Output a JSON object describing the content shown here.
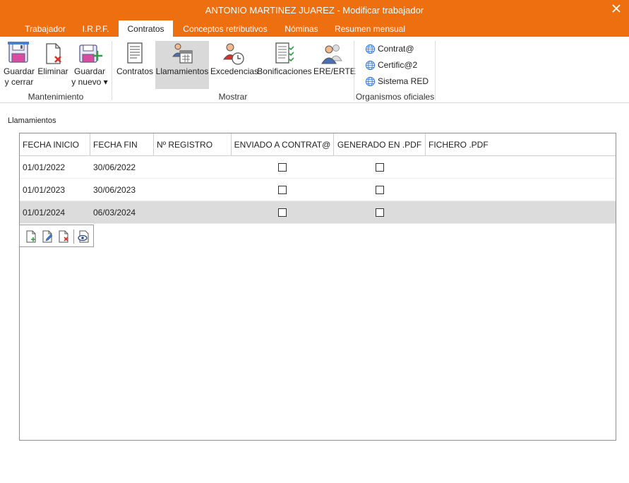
{
  "window": {
    "title": "ANTONIO MARTINEZ JUAREZ - Modificar trabajador"
  },
  "tabs": [
    {
      "label": "Trabajador",
      "active": false
    },
    {
      "label": "I.R.P.F.",
      "active": false
    },
    {
      "label": "Contratos",
      "active": true
    },
    {
      "label": "Conceptos retributivos",
      "active": false
    },
    {
      "label": "Nóminas",
      "active": false
    },
    {
      "label": "Resumen mensual",
      "active": false
    }
  ],
  "ribbon": {
    "mantenimiento": {
      "label": "Mantenimiento",
      "guardar_cerrar": {
        "line1": "Guardar",
        "line2": "y cerrar"
      },
      "eliminar": {
        "line1": "Eliminar"
      },
      "guardar_nuevo": {
        "line1": "Guardar",
        "line2": "y nuevo ▾"
      }
    },
    "mostrar": {
      "label": "Mostrar",
      "contratos": "Contratos",
      "llamamientos": "Llamamientos",
      "excedencias": "Excedencias",
      "bonificaciones": "Bonificaciones",
      "ere_erte": "ERE/ERTE"
    },
    "organismos": {
      "label": "Organismos oficiales",
      "contrata": "Contrat@",
      "certifica": "Certific@2",
      "sistema_red": "Sistema RED"
    }
  },
  "section": {
    "title": "Llamamientos"
  },
  "grid": {
    "columns": [
      "FECHA INICIO",
      "FECHA FIN",
      "Nº REGISTRO",
      "ENVIADO A CONTRAT@",
      "GENERADO EN .PDF",
      "FICHERO .PDF"
    ],
    "rows": [
      {
        "fecha_inicio": "01/01/2022",
        "fecha_fin": "30/06/2022",
        "registro": "",
        "enviado": false,
        "generado": false,
        "fichero": ""
      },
      {
        "fecha_inicio": "01/01/2023",
        "fecha_fin": "30/06/2023",
        "registro": "",
        "enviado": false,
        "generado": false,
        "fichero": ""
      },
      {
        "fecha_inicio": "01/01/2024",
        "fecha_fin": "06/03/2024",
        "registro": "",
        "enviado": false,
        "generado": false,
        "fichero": "",
        "selected": true
      }
    ]
  },
  "colors": {
    "accent": "#ee6f0f",
    "selected_row": "#dcdcdc"
  },
  "icons": {
    "guardar_cerrar": "save-close-icon",
    "eliminar": "delete-document-icon",
    "guardar_nuevo": "save-new-icon",
    "contratos": "contract-document-icon",
    "llamamientos": "people-calendar-icon",
    "excedencias": "person-clock-icon",
    "bonificaciones": "checklist-icon",
    "ere_erte": "people-group-icon",
    "globe": "globe-icon"
  }
}
